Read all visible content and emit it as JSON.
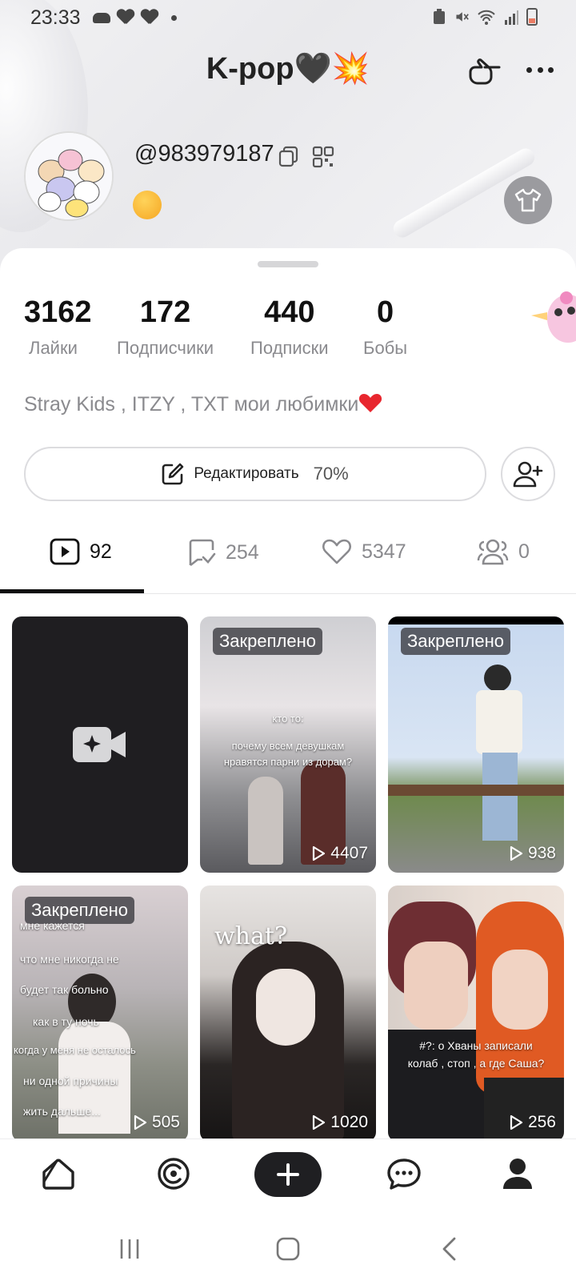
{
  "status_bar": {
    "time": "23:33"
  },
  "header": {
    "title": "K-pop🖤💥"
  },
  "profile": {
    "username": "@983979187"
  },
  "stats": [
    {
      "value": "3162",
      "label": "Лайки"
    },
    {
      "value": "172",
      "label": "Подписчики"
    },
    {
      "value": "440",
      "label": "Подписки"
    },
    {
      "value": "0",
      "label": "Бобы"
    }
  ],
  "bio": "Stray Kids , ITZY , TXT мои любимки",
  "edit_button": {
    "label": "Редактировать",
    "progress": "70%"
  },
  "tabs": [
    {
      "icon": "video-icon",
      "count": "92"
    },
    {
      "icon": "repost-icon",
      "count": "254"
    },
    {
      "icon": "heart-icon",
      "count": "5347"
    },
    {
      "icon": "friends-icon",
      "count": "0"
    }
  ],
  "grid": [
    {
      "type": "create",
      "icon": "camera-add-icon"
    },
    {
      "pinned": "Закреплено",
      "views": "4407",
      "caption1": "кто то:",
      "caption2": "почему всем девушкам",
      "caption3": "нравятся парни из дорам?"
    },
    {
      "pinned": "Закреплено",
      "views": "938"
    },
    {
      "pinned": "Закреплено",
      "views": "505",
      "lines": [
        "мне кажется",
        "что мне никогда не",
        "будет так больно",
        "как в ту ночь",
        "когда у меня не осталось",
        "ни одной причины",
        "жить дальше..."
      ]
    },
    {
      "views": "1020",
      "overlay": "what?"
    },
    {
      "views": "256",
      "caption1": "#?: о Хваны записали",
      "caption2": "колаб , стоп , а где Саша?"
    }
  ],
  "bottom_nav": [
    "home-icon",
    "discover-icon",
    "create-icon",
    "messages-icon",
    "profile-icon"
  ]
}
